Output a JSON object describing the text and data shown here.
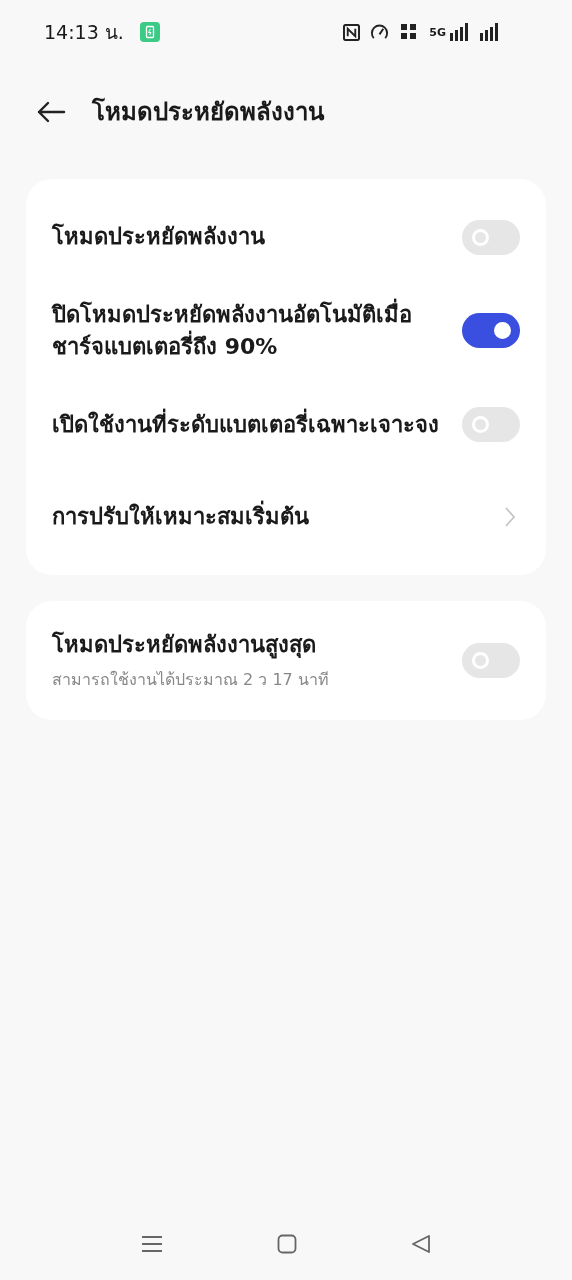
{
  "status_bar": {
    "time": "14:13 น.",
    "network": "5G"
  },
  "header": {
    "title": "โหมดประหยัดพลังงาน"
  },
  "cards": [
    {
      "rows": [
        {
          "kind": "toggle",
          "label": "โหมดประหยัดพลังงาน",
          "on": false
        },
        {
          "kind": "toggle",
          "label": "ปิดโหมดประหยัดพลังงานอัตโนมัติเมื่อชาร์จแบตเตอรี่ถึง 90%",
          "on": true
        },
        {
          "kind": "toggle",
          "label": "เปิดใช้งานที่ระดับแบตเตอรี่เฉพาะเจาะจง",
          "on": false
        },
        {
          "kind": "link",
          "label": "การปรับให้เหมาะสมเริ่มต้น"
        }
      ]
    },
    {
      "rows": [
        {
          "kind": "toggle",
          "label": "โหมดประหยัดพลังงานสูงสุด",
          "subtitle": "สามารถใช้งานได้ประมาณ 2 ว 17 นาที",
          "on": false
        }
      ]
    }
  ]
}
